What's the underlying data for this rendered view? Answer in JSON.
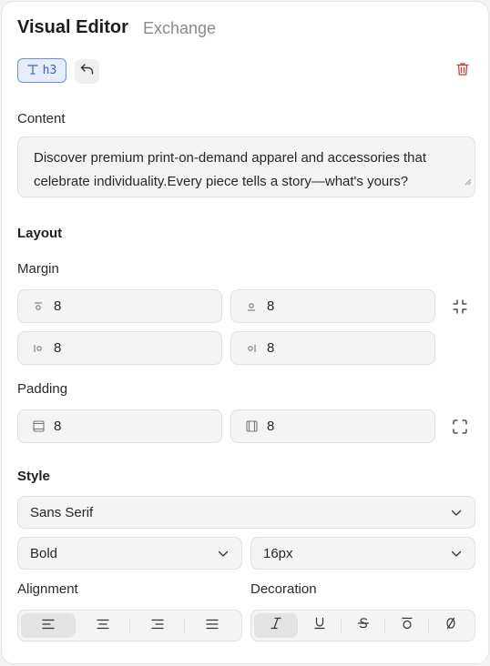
{
  "header": {
    "title": "Visual Editor",
    "secondary_tab": "Exchange"
  },
  "toolbar": {
    "tag_label": "h3",
    "tag_icon": "text-type-icon",
    "undo_icon": "undo-icon",
    "delete_icon": "trash-icon",
    "accent_color": "#3d63c9",
    "delete_color": "#d0393b"
  },
  "content": {
    "label": "Content",
    "text": "Discover premium print-on-demand apparel and accessories that celebrate individuality.Every piece tells a story—what's yours?"
  },
  "layout": {
    "heading": "Layout",
    "margin": {
      "label": "Margin",
      "top": "8",
      "bottom": "8",
      "left": "8",
      "right": "8",
      "link_icon": "collapse-corners-icon"
    },
    "padding": {
      "label": "Padding",
      "vertical": "8",
      "horizontal": "8",
      "link_icon": "expand-corners-icon"
    }
  },
  "style": {
    "heading": "Style",
    "font_family": "Sans Serif",
    "font_weight": "Bold",
    "font_size": "16px",
    "alignment_label": "Alignment",
    "decoration_label": "Decoration",
    "alignment_options": [
      "left",
      "center",
      "right",
      "justify"
    ],
    "alignment_selected": "left",
    "decoration_options": [
      "italic",
      "underline",
      "strikethrough",
      "overline",
      "none"
    ],
    "decoration_selected": "italic"
  }
}
